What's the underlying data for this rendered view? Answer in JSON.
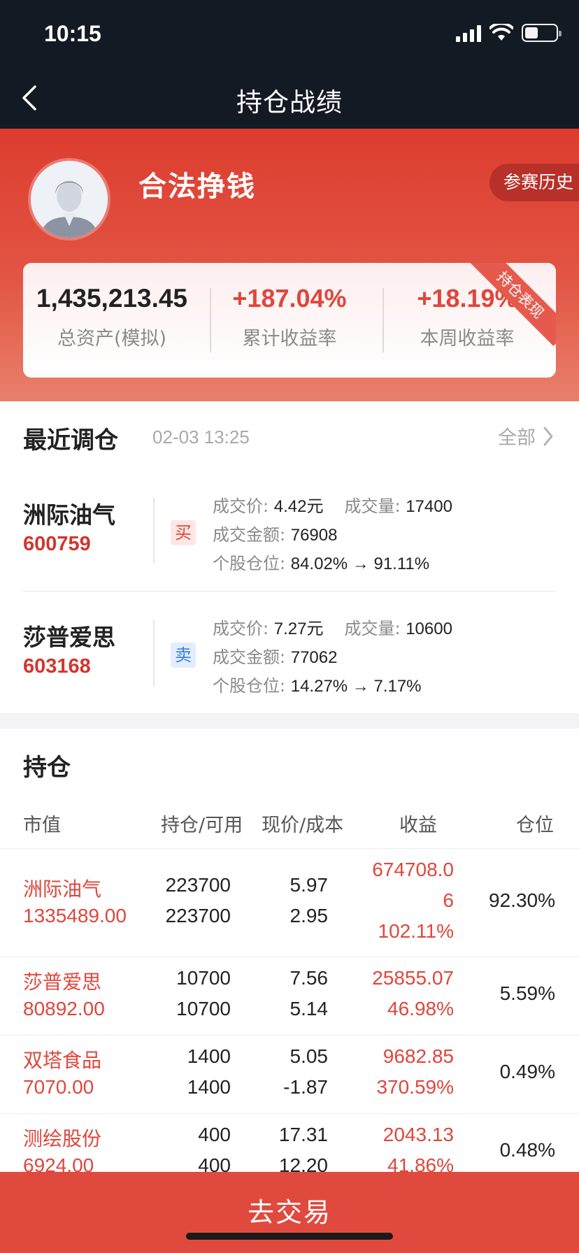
{
  "status_bar": {
    "time": "10:15"
  },
  "nav": {
    "title": "持仓战绩"
  },
  "profile": {
    "username": "合法挣钱",
    "history_button": "参赛历史"
  },
  "stats": {
    "total_assets": "1,435,213.45",
    "total_assets_label": "总资产(模拟)",
    "cumulative_return": "+187.04%",
    "cumulative_return_label": "累计收益率",
    "weekly_return": "+18.19%",
    "weekly_return_label": "本周收益率",
    "ribbon": "持仓表现"
  },
  "recent": {
    "title": "最近调仓",
    "time": "02-03 13:25",
    "all_link": "全部",
    "trades": [
      {
        "name": "洲际油气",
        "code": "600759",
        "side": "买",
        "price_label": "成交价:",
        "price": "4.42元",
        "volume_label": "成交量:",
        "volume": "17400",
        "amount_label": "成交金额:",
        "amount": "76908",
        "position_label": "个股仓位:",
        "position": "84.02% → 91.11%"
      },
      {
        "name": "莎普爱思",
        "code": "603168",
        "side": "卖",
        "price_label": "成交价:",
        "price": "7.27元",
        "volume_label": "成交量:",
        "volume": "10600",
        "amount_label": "成交金额:",
        "amount": "77062",
        "position_label": "个股仓位:",
        "position": "14.27% → 7.17%"
      }
    ]
  },
  "holdings": {
    "title": "持仓",
    "columns": [
      "市值",
      "持仓/可用",
      "现价/成本",
      "收益",
      "仓位"
    ],
    "rows": [
      {
        "name": "洲际油气",
        "value": "1335489.00",
        "hold": "223700",
        "avail": "223700",
        "price": "5.97",
        "cost": "2.95",
        "profit_a": "674708.0",
        "profit_b": "6",
        "profit_pct": "102.11%",
        "weight": "92.30%"
      },
      {
        "name": "莎普爱思",
        "value": "80892.00",
        "hold": "10700",
        "avail": "10700",
        "price": "7.56",
        "cost": "5.14",
        "profit": "25855.07",
        "profit_pct": "46.98%",
        "weight": "5.59%"
      },
      {
        "name": "双塔食品",
        "value": "7070.00",
        "hold": "1400",
        "avail": "1400",
        "price": "5.05",
        "cost": "-1.87",
        "profit": "9682.85",
        "profit_pct": "370.59%",
        "weight": "0.49%"
      },
      {
        "name": "测绘股份",
        "value": "6924.00",
        "hold": "400",
        "avail": "400",
        "price": "17.31",
        "cost": "12.20",
        "profit": "2043.13",
        "profit_pct": "41.86%",
        "weight": "0.48%"
      }
    ]
  },
  "cta": {
    "label": "去交易"
  }
}
